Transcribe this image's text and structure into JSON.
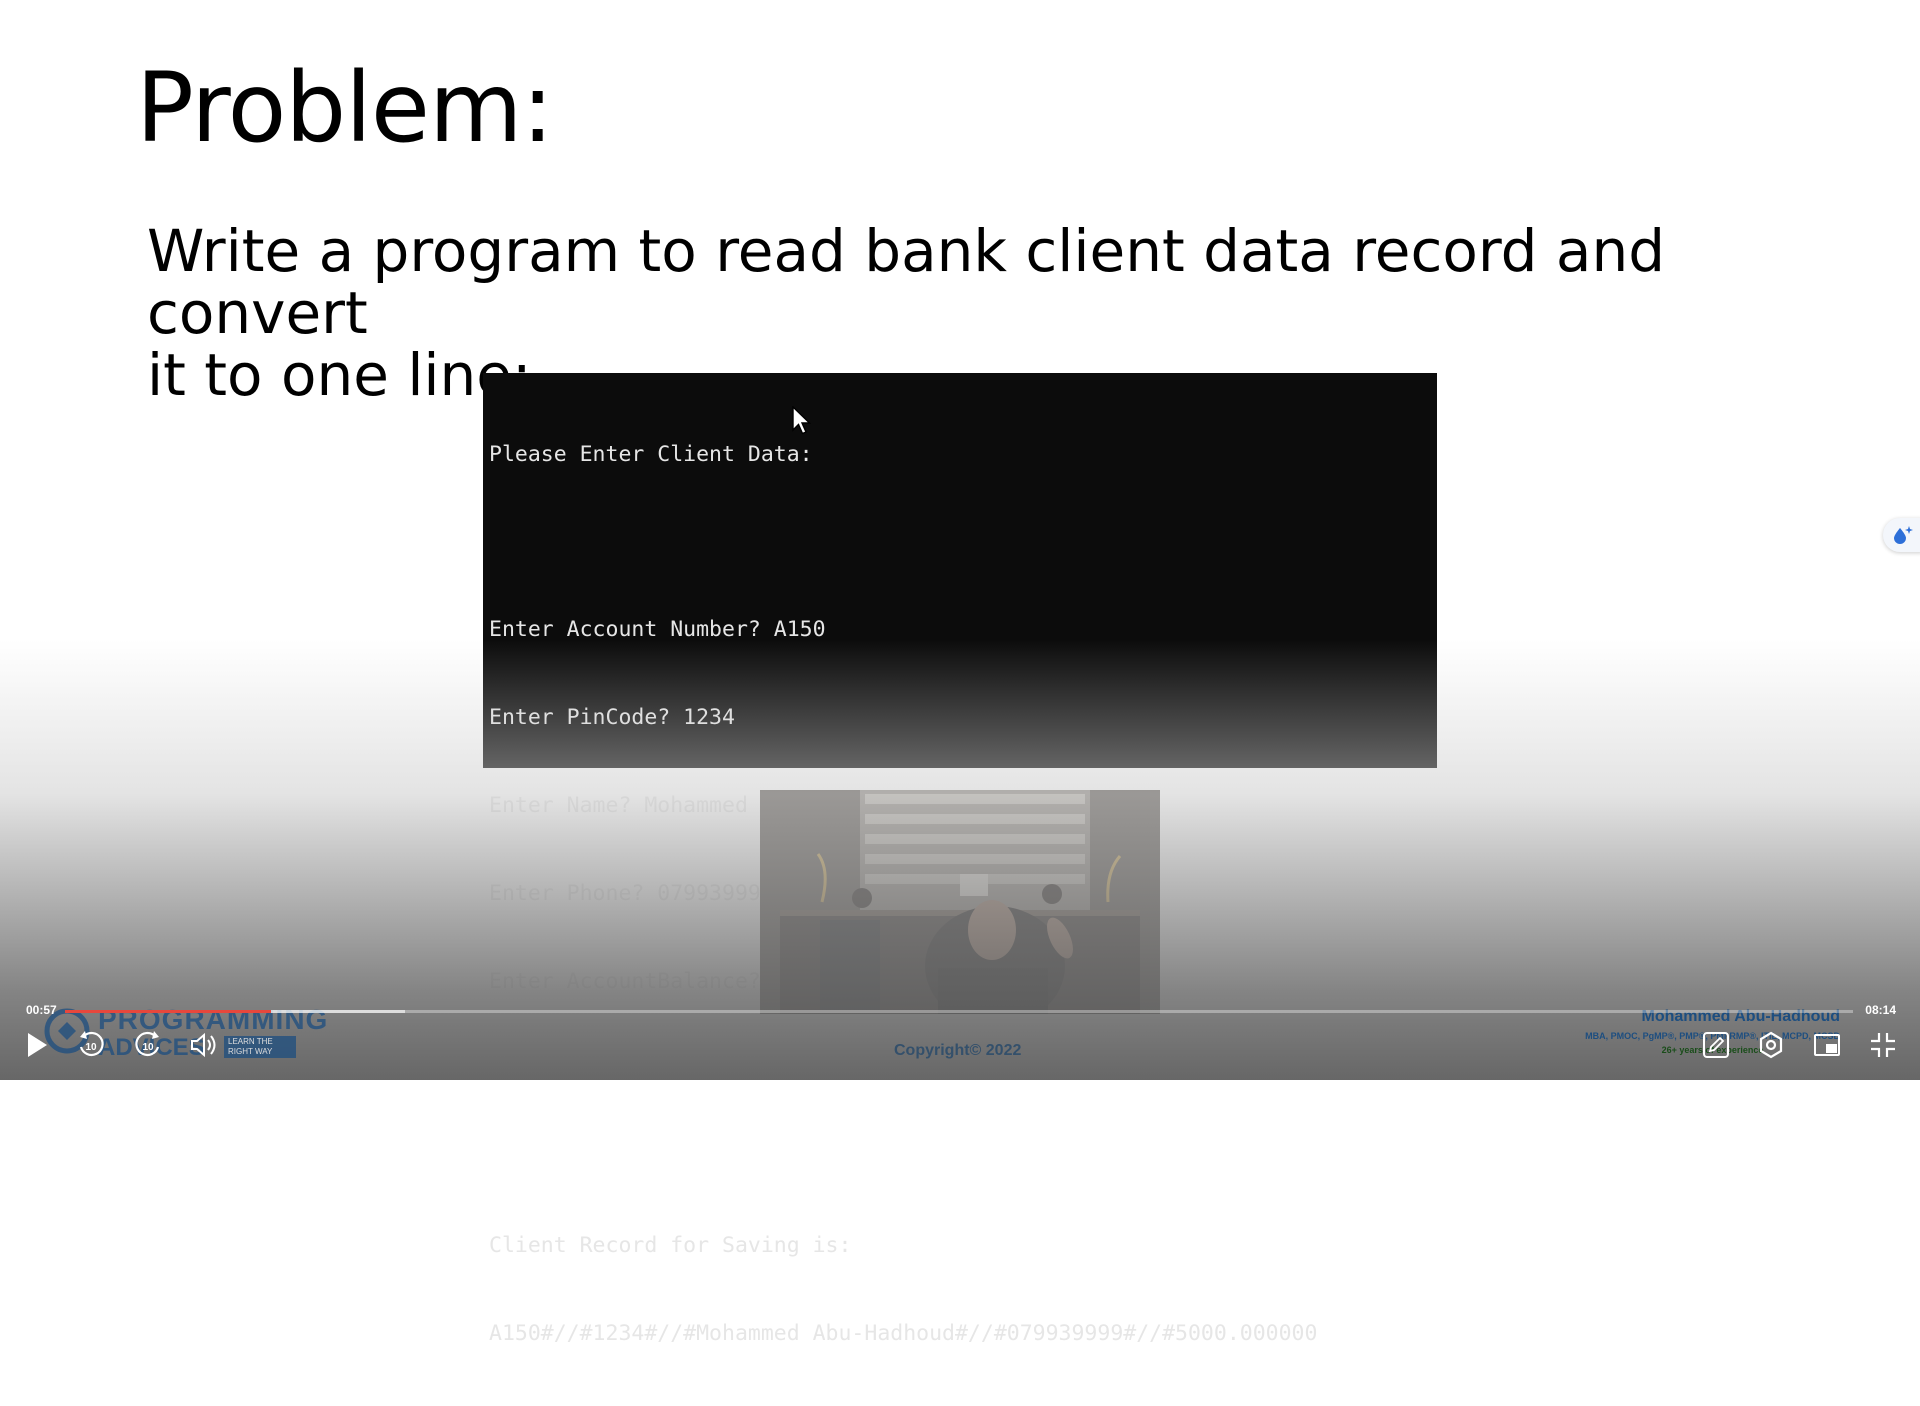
{
  "slide": {
    "title": "Problem:",
    "statement_line1": "Write a program to read bank client data record and convert",
    "statement_line2": "it to one line:"
  },
  "terminal": {
    "lines": [
      "Please Enter Client Data:",
      "",
      "Enter Account Number? A150",
      "Enter PinCode? 1234",
      "Enter Name? Mohammed Abu-Hadhoud",
      "Enter Phone? 079939999",
      "Enter AccountBalance? 5000",
      "",
      "",
      "Client Record for Saving is:",
      "A150#//#1234#//#Mohammed Abu-Hadhoud#//#079939999#//#5000.000000"
    ]
  },
  "branding": {
    "logo_word1": "PROGRAMMING",
    "logo_word2": "ADVICES",
    "logo_tagline": "LEARN THE RIGHT WAY",
    "copyright": "Copyright© 2022",
    "author_name": "Mohammed Abu-Hadhoud",
    "author_credentials": "MBA, PMOC, PgMP®, PMP®, PMI-RMP®, ITIL, MCPD, MCSD",
    "author_experience": "26+ years of experience"
  },
  "player": {
    "current_time": "00:57",
    "total_time": "08:14",
    "progress_fraction": 0.115,
    "buffered_fraction": 0.19,
    "accent_color": "#e7473c",
    "controls": {
      "play": "play-icon",
      "rewind": "rewind-10-icon",
      "forward": "forward-10-icon",
      "volume": "volume-icon",
      "annotate": "pencil-icon",
      "settings": "settings-icon",
      "pip": "picture-in-picture-icon",
      "fullscreen": "exit-fullscreen-icon"
    },
    "skip_label": "10"
  }
}
